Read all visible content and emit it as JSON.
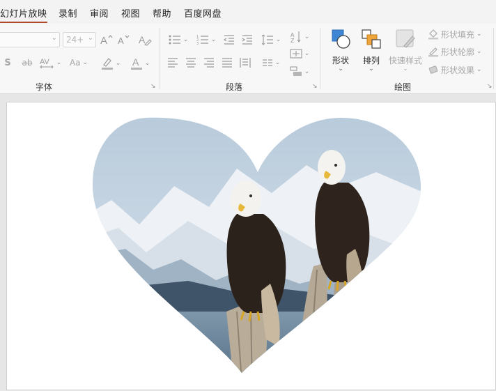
{
  "tabs": [
    {
      "label": "幻灯片放映",
      "active": true
    },
    {
      "label": "录制"
    },
    {
      "label": "审阅"
    },
    {
      "label": "视图"
    },
    {
      "label": "帮助"
    },
    {
      "label": "百度网盘"
    }
  ],
  "font_group": {
    "label": "字体",
    "font_name_value": "",
    "font_size_value": "24+"
  },
  "paragraph_group": {
    "label": "段落"
  },
  "drawing_group": {
    "label": "绘图",
    "shapes_label": "形状",
    "arrange_label": "排列",
    "quick_styles_label": "快速样式",
    "shape_fill_label": "形状填充",
    "shape_outline_label": "形状轮廓",
    "shape_effects_label": "形状效果"
  },
  "colors": {
    "active_tab_underline": "#b04a2f",
    "shape_icon_blue": "#3f86d4",
    "arrange_icon_orange": "#f0a53a"
  },
  "slide": {
    "picture": "heart-shaped photo of two bald eagles perched on driftwood with snowy mountains behind"
  }
}
